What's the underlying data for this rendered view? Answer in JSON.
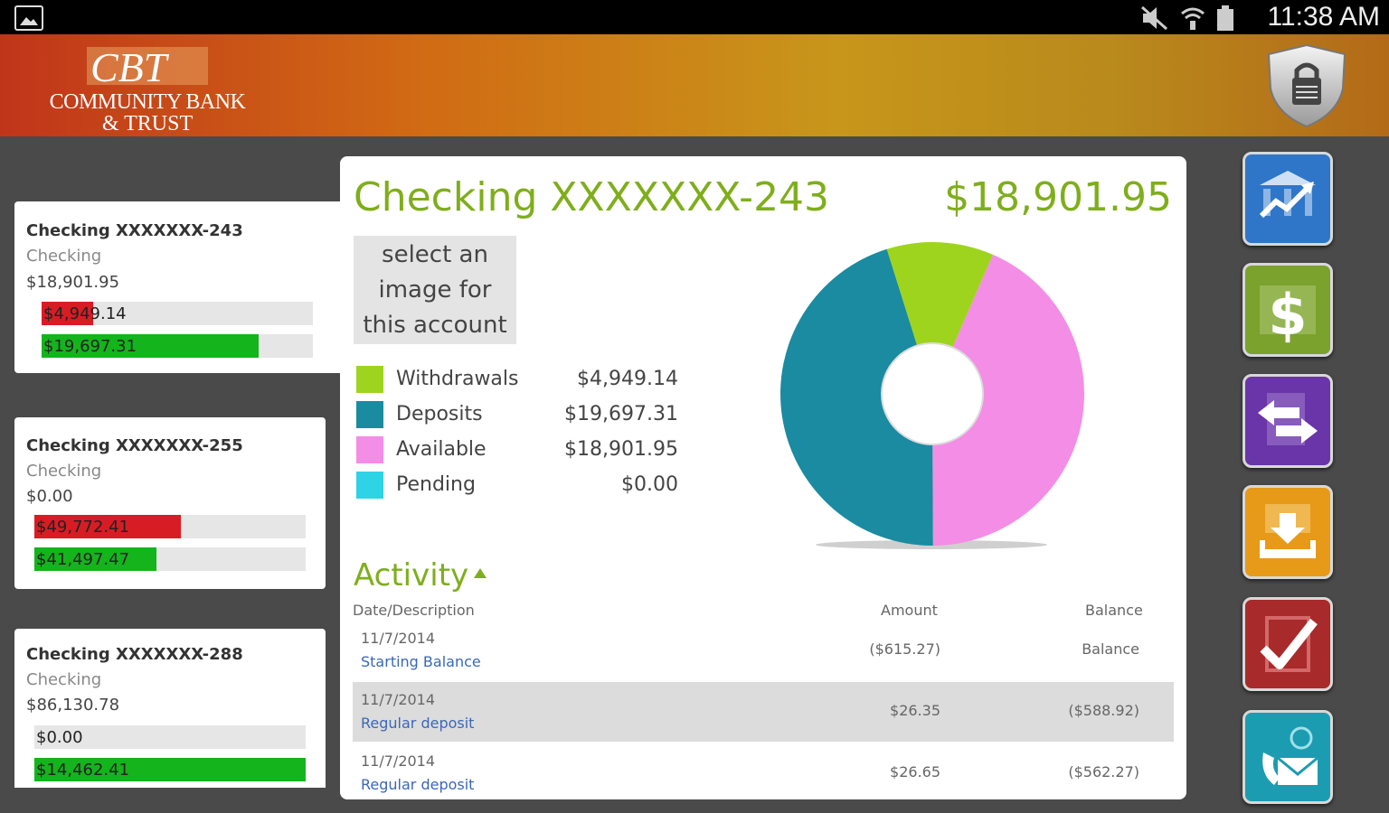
{
  "status_bar": {
    "time": "11:38 AM"
  },
  "brand": {
    "logo_text": "CBT",
    "name_line1": "COMMUNITY BANK",
    "name_line2": "& TRUST"
  },
  "accounts": [
    {
      "name": "Checking XXXXXXX-243",
      "type": "Checking",
      "balance": "$18,901.95",
      "withdrawals_label": "$4,949.14",
      "withdrawals_fill": 0.19,
      "deposits_label": "$19,697.31",
      "deposits_fill": 0.8
    },
    {
      "name": "Checking XXXXXXX-255",
      "type": "Checking",
      "balance": "$0.00",
      "withdrawals_label": "$49,772.41",
      "withdrawals_fill": 0.54,
      "deposits_label": "$41,497.47",
      "deposits_fill": 0.45
    },
    {
      "name": "Checking XXXXXXX-288",
      "type": "Checking",
      "balance": "$86,130.78",
      "withdrawals_label": "$0.00",
      "withdrawals_fill": 0.0,
      "deposits_label": "$14,462.41",
      "deposits_fill": 1.0
    }
  ],
  "detail": {
    "title": "Checking XXXXXXX-243",
    "amount": "$18,901.95",
    "image_placeholder": [
      "select an",
      "image for",
      "this account"
    ],
    "legend": [
      {
        "name": "Withdrawals",
        "value": "$4,949.14",
        "color": "#9ed41e"
      },
      {
        "name": "Deposits",
        "value": "$19,697.31",
        "color": "#1a8ba0"
      },
      {
        "name": "Available",
        "value": "$18,901.95",
        "color": "#f48de6"
      },
      {
        "name": "Pending",
        "value": "$0.00",
        "color": "#2ed3e6"
      }
    ]
  },
  "chart_data": {
    "type": "pie",
    "categories": [
      "Withdrawals",
      "Deposits",
      "Available",
      "Pending"
    ],
    "values": [
      4949.14,
      19697.31,
      18901.95,
      0.0
    ],
    "colors": [
      "#9ed41e",
      "#1a8ba0",
      "#f48de6",
      "#2ed3e6"
    ]
  },
  "activity": {
    "title": "Activity",
    "headers": {
      "date_desc": "Date/Description",
      "amount": "Amount",
      "balance": "Balance"
    },
    "rows": [
      {
        "date": "11/7/2014",
        "description": "Starting Balance",
        "amount": "($615.27)",
        "balance": "Balance"
      },
      {
        "date": "11/7/2014",
        "description": "Regular deposit",
        "amount": "$26.35",
        "balance": "($588.92)"
      },
      {
        "date": "11/7/2014",
        "description": "Regular deposit",
        "amount": "$26.65",
        "balance": "($562.27)"
      }
    ]
  },
  "nav": [
    {
      "icon": "bank-chart-icon",
      "color": "#2f76c9"
    },
    {
      "icon": "dollar-icon",
      "color": "#7aa22c"
    },
    {
      "icon": "transfer-arrows-icon",
      "color": "#6a35a8"
    },
    {
      "icon": "deposit-download-icon",
      "color": "#e69a18"
    },
    {
      "icon": "checkmark-icon",
      "color": "#a82a2a"
    },
    {
      "icon": "contact-mail-icon",
      "color": "#1c9cb0"
    }
  ]
}
